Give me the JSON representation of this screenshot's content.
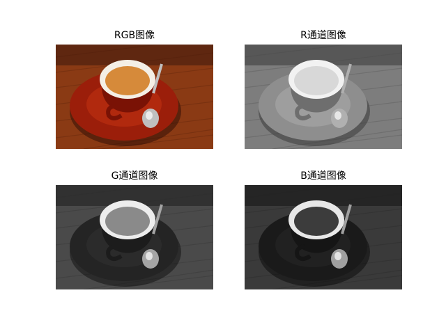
{
  "figure": {
    "panels": [
      {
        "title": "RGB图像",
        "channel": "rgb"
      },
      {
        "title": "R通道图像",
        "channel": "r"
      },
      {
        "title": "G通道图像",
        "channel": "g"
      },
      {
        "title": "B通道图像",
        "channel": "b"
      }
    ]
  }
}
